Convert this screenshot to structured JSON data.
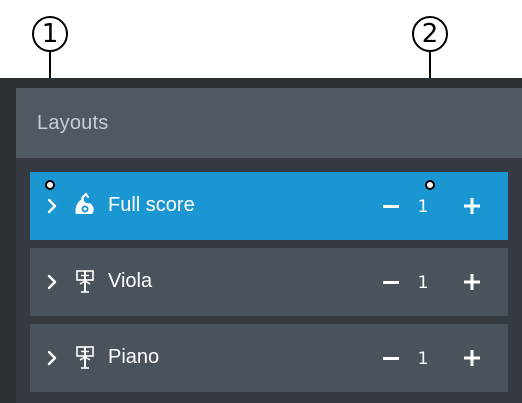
{
  "callouts": [
    "1",
    "2"
  ],
  "panel": {
    "title": "Layouts"
  },
  "layouts": [
    {
      "label": "Full score",
      "count": "1",
      "icon": "full-score-icon",
      "selected": true
    },
    {
      "label": "Viola",
      "count": "1",
      "icon": "part-layout-icon",
      "selected": false
    },
    {
      "label": "Piano",
      "count": "1",
      "icon": "part-layout-icon",
      "selected": false
    }
  ],
  "colors": {
    "selected_row": "#1a96d3",
    "row": "#4a535b",
    "header": "#4e5962",
    "panel": "#2b3035"
  }
}
